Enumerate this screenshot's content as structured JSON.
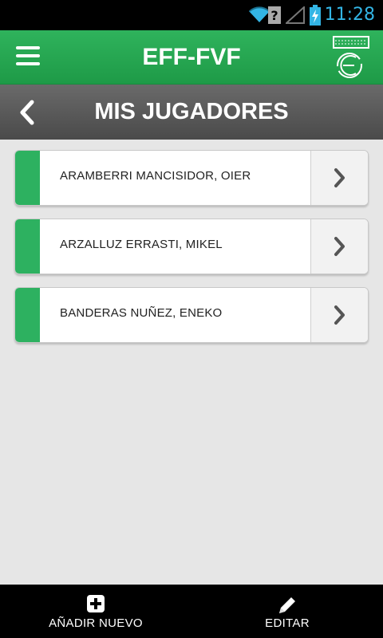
{
  "status_bar": {
    "time": "11:28",
    "icons": [
      "wifi-icon",
      "question-icon",
      "signal-icon",
      "battery-charging-icon"
    ]
  },
  "header": {
    "title": "EFF-FVF",
    "menu_icon": "hamburger-menu-icon",
    "logo": "federation-logo"
  },
  "subheader": {
    "title": "MIS JUGADORES",
    "back_icon": "chevron-left-icon"
  },
  "players": [
    {
      "name": "ARAMBERRI MANCISIDOR, OIER"
    },
    {
      "name": "ARZALLUZ ERRASTI, MIKEL"
    },
    {
      "name": "BANDERAS NUÑEZ, ENEKO"
    }
  ],
  "bottom_bar": {
    "add_label": "AÑADIR NUEVO",
    "edit_label": "EDITAR"
  },
  "colors": {
    "header_green": "#26a851",
    "accent_green": "#2db160",
    "subheader_gray": "#555555",
    "status_blue": "#33b5e5"
  }
}
